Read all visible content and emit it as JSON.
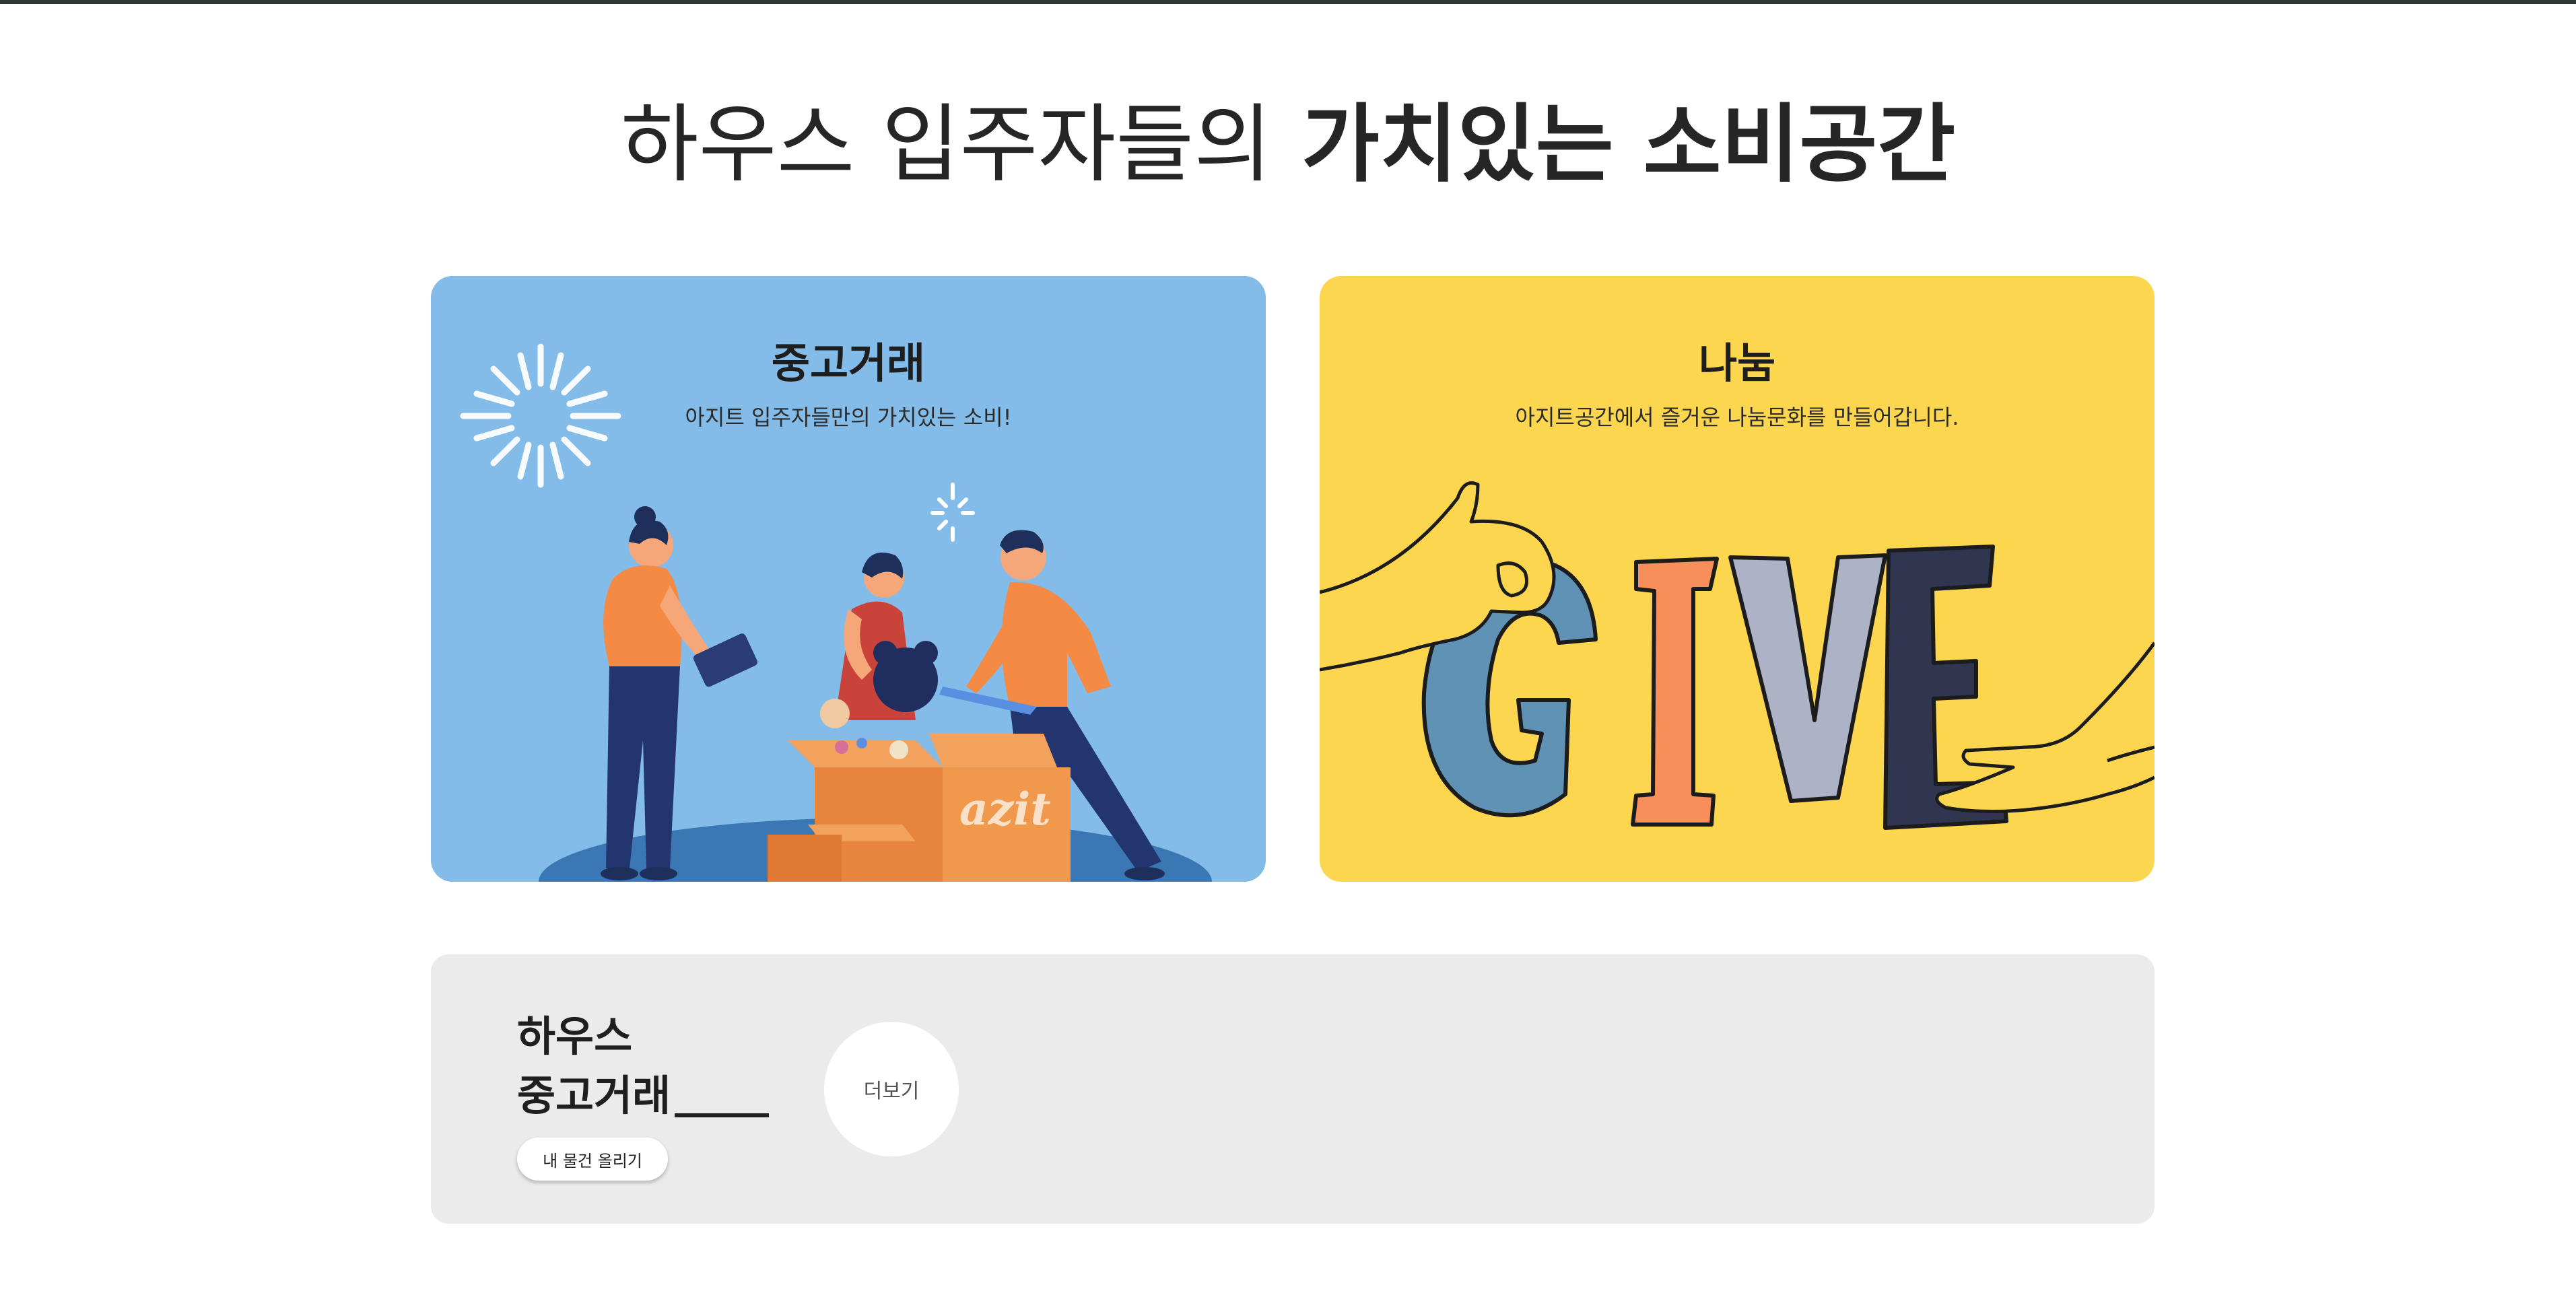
{
  "hero": {
    "title_light": "하우스 입주자들의",
    "title_bold": "가치있는 소비공간"
  },
  "cards": {
    "used": {
      "title": "중고거래",
      "subtitle": "아지트 입주자들만의 가치있는 소비!",
      "box_logo": "azit",
      "bg_color": "#84bce9"
    },
    "share": {
      "title": "나눔",
      "subtitle": "아지트공간에서 즐거운 나눔문화를 만들어갑니다.",
      "art_letters": [
        "G",
        "I",
        "V",
        "E"
      ],
      "bg_color": "#fdd64f"
    }
  },
  "strip": {
    "title_line1": "하우스",
    "title_line2": "중고거래",
    "upload_label": "내 물건 올리기",
    "more_label": "더보기"
  },
  "icons": [
    "fireworks-icon",
    "sparkle-icon"
  ]
}
